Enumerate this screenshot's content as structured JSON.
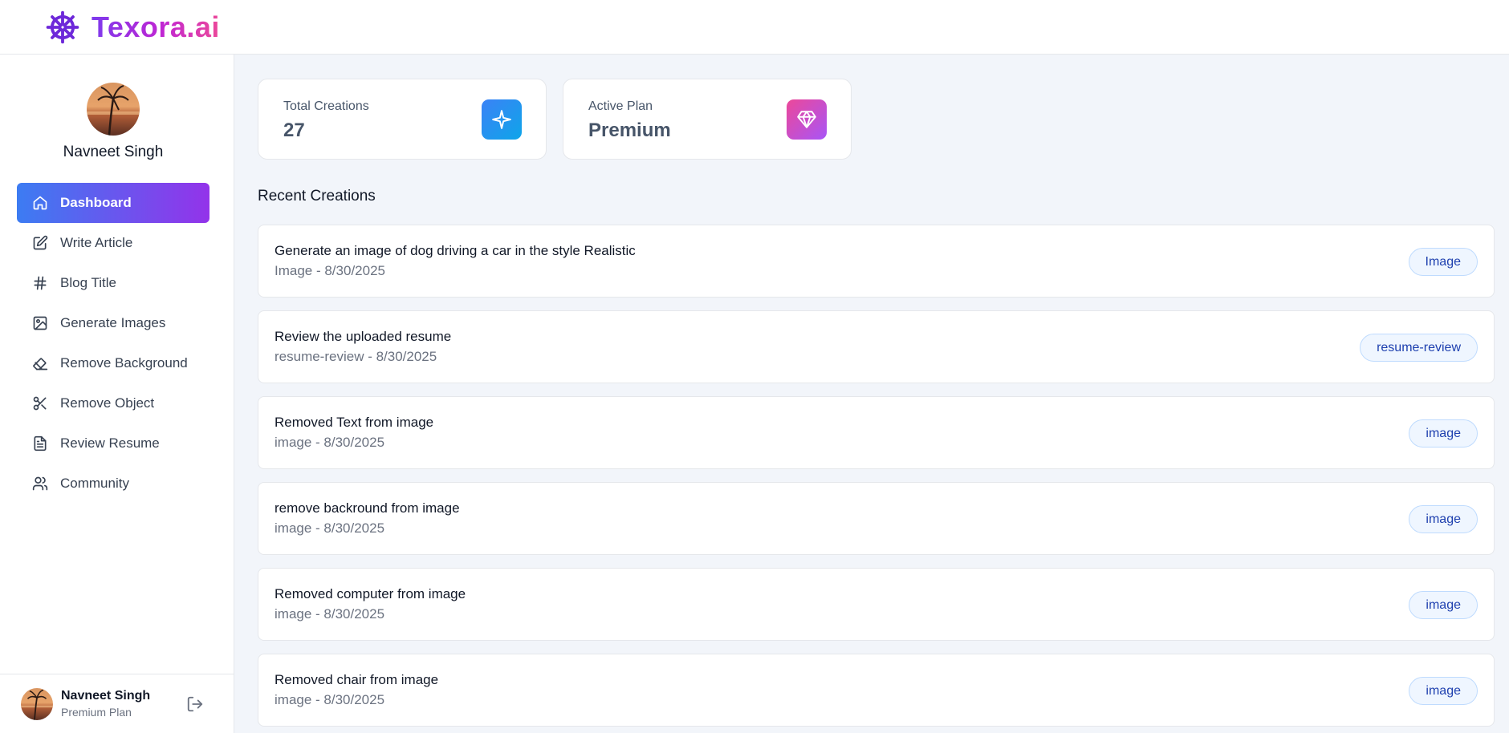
{
  "brand": {
    "name": "Texora.ai"
  },
  "user": {
    "name": "Navneet Singh",
    "plan": "Premium Plan"
  },
  "nav": {
    "items": [
      {
        "label": "Dashboard",
        "icon": "home-icon",
        "active": true
      },
      {
        "label": "Write Article",
        "icon": "edit-icon",
        "active": false
      },
      {
        "label": "Blog Title",
        "icon": "hash-icon",
        "active": false
      },
      {
        "label": "Generate Images",
        "icon": "image-icon",
        "active": false
      },
      {
        "label": "Remove Background",
        "icon": "eraser-icon",
        "active": false
      },
      {
        "label": "Remove Object",
        "icon": "scissors-icon",
        "active": false
      },
      {
        "label": "Review Resume",
        "icon": "file-text-icon",
        "active": false
      },
      {
        "label": "Community",
        "icon": "users-icon",
        "active": false
      }
    ]
  },
  "stats": {
    "total": {
      "label": "Total Creations",
      "value": "27",
      "icon": "sparkle-icon",
      "color": "#1e8fe1"
    },
    "plan": {
      "label": "Active Plan",
      "value": "Premium",
      "icon": "gem-icon",
      "color": "#d946ef"
    }
  },
  "recent": {
    "title": "Recent Creations",
    "items": [
      {
        "title": "Generate an image of dog driving a car in the style Realistic",
        "meta": "Image - 8/30/2025",
        "badge": "Image"
      },
      {
        "title": "Review the uploaded resume",
        "meta": "resume-review - 8/30/2025",
        "badge": "resume-review"
      },
      {
        "title": "Removed Text from image",
        "meta": "image - 8/30/2025",
        "badge": "image"
      },
      {
        "title": "remove backround from image",
        "meta": "image - 8/30/2025",
        "badge": "image"
      },
      {
        "title": "Removed computer from image",
        "meta": "image - 8/30/2025",
        "badge": "image"
      },
      {
        "title": "Removed chair from image",
        "meta": "image - 8/30/2025",
        "badge": "image"
      }
    ]
  },
  "colors": {
    "accent_start": "#3c7cf2",
    "accent_end": "#9333ea",
    "brand_purple": "#7c3aed"
  }
}
